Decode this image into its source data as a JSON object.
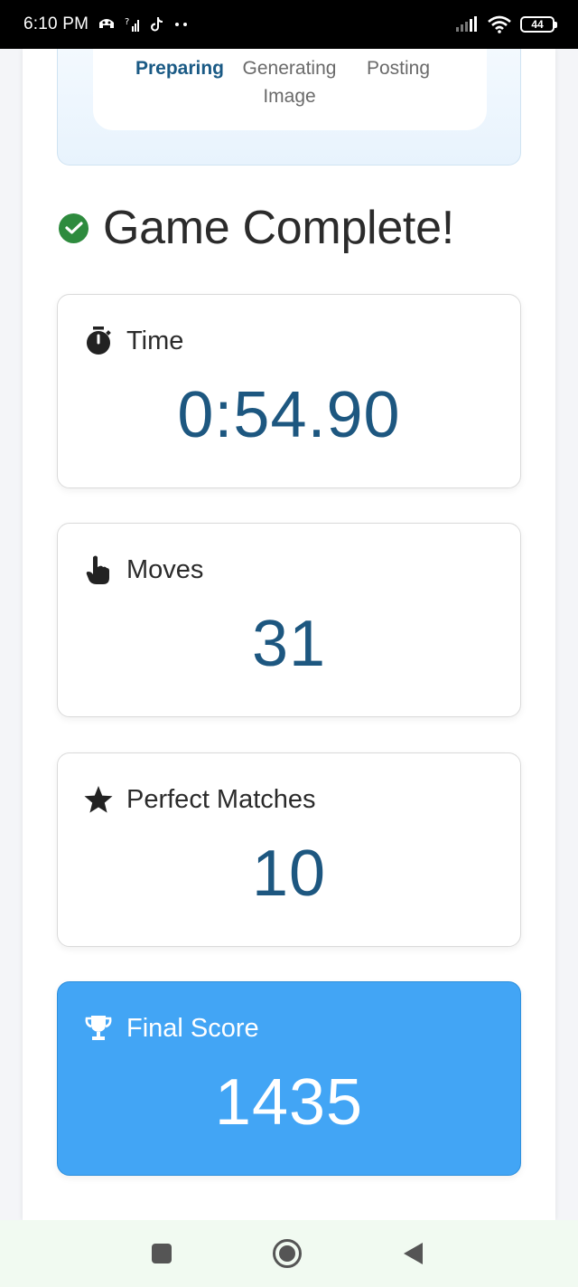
{
  "status_bar": {
    "time": "6:10 PM",
    "battery": "44",
    "icons": [
      "app-icon",
      "signal-unknown-icon",
      "tiktok-icon",
      "more-dots-icon",
      "signal-bars-icon",
      "wifi-icon",
      "battery-icon"
    ]
  },
  "progress": {
    "steps": [
      {
        "label": "Preparing",
        "active": true
      },
      {
        "label": "Generating Image",
        "active": false
      },
      {
        "label": "Posting",
        "active": false
      }
    ],
    "active_color": "#1a5a85"
  },
  "heading": {
    "title": "Game Complete!",
    "icon": "check-circle-icon",
    "icon_color": "#2e8b3e"
  },
  "stats": [
    {
      "label": "Time",
      "value": "0:54.90",
      "icon": "stopwatch-icon"
    },
    {
      "label": "Moves",
      "value": "31",
      "icon": "pointer-hand-icon"
    },
    {
      "label": "Perfect Matches",
      "value": "10",
      "icon": "star-icon"
    },
    {
      "label": "Final Score",
      "value": "1435",
      "icon": "trophy-icon",
      "highlight_color": "#42a5f5"
    }
  ],
  "colors": {
    "value_text": "#1d5780",
    "score_bg": "#42a5f5"
  },
  "nav": {
    "buttons": [
      "recents-button",
      "home-button",
      "back-button"
    ]
  }
}
